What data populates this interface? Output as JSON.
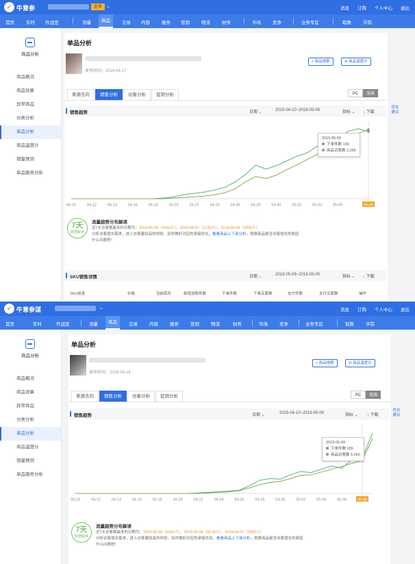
{
  "panels": [
    {
      "brand": "牛意参",
      "shop_badge": "企业",
      "top_links": [
        "消息",
        "订购",
        "个人中心",
        "退出"
      ],
      "nav": [
        "首页",
        "实时",
        "作战室",
        "流量",
        "商品",
        "交易",
        "内容",
        "服务",
        "营销",
        "物流",
        "财务",
        "市场",
        "竞争",
        "业务专区",
        "取数",
        "学院"
      ],
      "nav_active": "商品",
      "sidebar": {
        "title": "商品分析",
        "items": [
          "商品概况",
          "商品效果",
          "异常商品",
          "分类分析",
          "单品分析",
          "商品温度计",
          "销量预测",
          "单品服务分析"
        ],
        "active": "单品分析"
      },
      "page_title": "单品分析",
      "publish_time": "发布时间：2019-04-17",
      "btn_search": "商品搜索",
      "btn_thermo": "商品温度计",
      "tabs": [
        "来源去向",
        "销售分析",
        "访客分析",
        "促销分析"
      ],
      "tab_active": "销售分析",
      "seg": [
        "PC",
        "无线"
      ],
      "section1_title": "销售趋势",
      "date_label": "日期",
      "date_range": "2019-04-10~2019-05-09",
      "metric_label": "指标",
      "download": "下载",
      "corner_link": "优化建议",
      "tooltip": {
        "date": "2019-05-09",
        "row1": "下单件数",
        "row1_val": "100",
        "row2": "商品访客数",
        "row2_val": "2,055"
      },
      "ai_badge_num": "7天",
      "ai_badge_sub": "数据解读",
      "ai_title": "流量趋势分布解读",
      "ai_line1_pre": "近7天访客数最多的日期为：",
      "ai_line1_a": "2019-05-09（2262人）",
      "ai_line1_b": "2019-05-07（2120人）",
      "ai_line1_c": "2019-05-08（2055人）",
      "ai_line2_pre": "分析访客增长需求，进入访客量较高的时段，及时做好对应的承接优化。",
      "ai_line2_link": "看看商品上下架分析",
      "ai_line2_post": "，观察商品是否访客增长的原因",
      "ai_line3": "什么问题吧！",
      "section2_title": "SKU销售详情",
      "date_range2": "2019-05-09~2019-05-09",
      "table_headers": [
        "SKU信息",
        "价格",
        "当前库存",
        "新增加购件数",
        "下单件数",
        "下单买家数",
        "支付件数",
        "支付买家数",
        "操作"
      ]
    },
    {
      "brand": "牛意参谋",
      "top_links": [
        "消息",
        "订购",
        "个人中心",
        "退出"
      ],
      "nav": [
        "首页",
        "实时",
        "作战室",
        "流量",
        "商品",
        "交易",
        "内容",
        "服务",
        "营销",
        "物流",
        "财务",
        "市场",
        "竞争",
        "业务专区",
        "取数",
        "学院"
      ],
      "nav_active": "商品",
      "sidebar": {
        "title": "商品分析",
        "items": [
          "商品概况",
          "商品效果",
          "异常商品",
          "分类分析",
          "单品分析",
          "商品温度计",
          "销量预测",
          "单品服务分析"
        ],
        "active": "单品分析"
      },
      "page_title": "单品分析",
      "publish_time": "发布时间：2019-04-16",
      "btn_search": "商品搜索",
      "btn_thermo": "商品温度计",
      "tabs": [
        "来源去向",
        "销售分析",
        "访客分析",
        "促销分析"
      ],
      "tab_active": "销售分析",
      "seg": [
        "PC",
        "无线"
      ],
      "section1_title": "销售趋势",
      "date_label": "日期",
      "date_range": "2019-04-10~2019-05-09",
      "metric_label": "指标",
      "download": "下载",
      "corner_link": "优化建议",
      "tooltip": {
        "date": "2019-05-09",
        "row1": "下单件数",
        "row1_val": "155",
        "row2": "商品访客数",
        "row2_val": "6,060"
      },
      "ai_badge_num": "7天",
      "ai_badge_sub": "数据解读",
      "ai_title": "流量趋势分布解读",
      "ai_line1_pre": "近7天访客数最多的日期为：",
      "ai_line1_a": "2019-05-09（6262人）",
      "ai_line1_b": "2019-05-08（6179人）",
      "ai_line1_c": "2019-05-07（5852人）",
      "ai_line2_pre": "分析访客增长需求，进入访客量较高的时段，及时做好对应的承接优化。",
      "ai_line2_link": "看看商品上下架分析",
      "ai_line2_post": "，观察商品是否访客增长的原因",
      "ai_line3": "什么问题吧！"
    }
  ],
  "chart_data": [
    {
      "type": "line",
      "x": [
        "04-10",
        "04-11",
        "04-12",
        "04-13",
        "04-14",
        "04-15",
        "04-16",
        "04-17",
        "04-18",
        "04-19",
        "04-20",
        "04-21",
        "04-22",
        "04-23",
        "04-24",
        "04-25",
        "04-26",
        "04-27",
        "04-28",
        "04-29",
        "04-30",
        "05-01",
        "05-02",
        "05-03",
        "05-04",
        "05-05",
        "05-06",
        "05-07",
        "05-08",
        "05-09"
      ],
      "xticks": [
        "04-10",
        "04-12",
        "04-14",
        "04-16",
        "04-18",
        "04-20",
        "04-22",
        "04-24",
        "04-26",
        "04-28",
        "04-30",
        "05-02",
        "05-04",
        "05-06",
        "05-09"
      ],
      "series": [
        {
          "name": "下单件数",
          "color": "#4caf93",
          "values": [
            0,
            0,
            0,
            0,
            0,
            0,
            0,
            0,
            0,
            1,
            3,
            6,
            8,
            10,
            13,
            17,
            25,
            36,
            50,
            44,
            49,
            56,
            63,
            68,
            78,
            84,
            90,
            100,
            104,
            100
          ]
        },
        {
          "name": "商品访客数",
          "color": "#8aa84b",
          "values": [
            0,
            0,
            0,
            0,
            0,
            0,
            0,
            0,
            0,
            0,
            1,
            2,
            3,
            4,
            6,
            9,
            15,
            25,
            33,
            30,
            35,
            43,
            50,
            58,
            66,
            74,
            82,
            90,
            97,
            103
          ]
        }
      ],
      "ylim": [
        0,
        110
      ],
      "grid": false,
      "highlight_x": "05-09"
    },
    {
      "type": "line",
      "x": [
        "04-10",
        "04-11",
        "04-12",
        "04-13",
        "04-14",
        "04-15",
        "04-16",
        "04-17",
        "04-18",
        "04-19",
        "04-20",
        "04-21",
        "04-22",
        "04-23",
        "04-24",
        "04-25",
        "04-26",
        "04-27",
        "04-28",
        "04-29",
        "04-30",
        "05-01",
        "05-02",
        "05-03",
        "05-04",
        "05-05",
        "05-06",
        "05-07",
        "05-08",
        "05-09"
      ],
      "xticks": [
        "04-10",
        "04-12",
        "04-14",
        "04-16",
        "04-18",
        "04-20",
        "04-22",
        "04-24",
        "04-26",
        "04-28",
        "04-30",
        "05-02",
        "05-04",
        "05-06",
        "05-08"
      ],
      "series": [
        {
          "name": "下单件数",
          "color": "#4caf93",
          "values": [
            0,
            0,
            0,
            0,
            0,
            0,
            0,
            0,
            0,
            0,
            0,
            0,
            1,
            2,
            3,
            4,
            6,
            14,
            24,
            27,
            26,
            34,
            40,
            38,
            44,
            50,
            46,
            62,
            64,
            110
          ]
        },
        {
          "name": "商品访客数",
          "color": "#8aa84b",
          "values": [
            0,
            0,
            0,
            0,
            0,
            0,
            0,
            0,
            0,
            0,
            0,
            0,
            0,
            1,
            2,
            3,
            5,
            10,
            16,
            20,
            22,
            27,
            33,
            34,
            39,
            44,
            49,
            55,
            60,
            100
          ]
        }
      ],
      "ylim": [
        0,
        120
      ],
      "grid": false,
      "highlight_x": "05-08"
    }
  ]
}
